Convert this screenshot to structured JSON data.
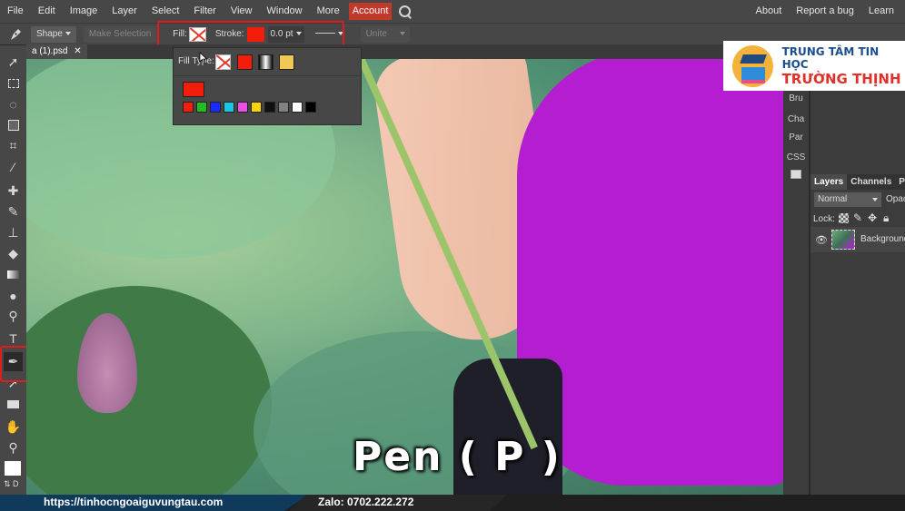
{
  "menu": {
    "items": [
      "File",
      "Edit",
      "Image",
      "Layer",
      "Select",
      "Filter",
      "View",
      "Window",
      "More",
      "Account"
    ],
    "right": [
      "About",
      "Report a bug",
      "Learn"
    ],
    "active_color": "#c0392b"
  },
  "options": {
    "shape_label": "Shape",
    "make_selection": "Make Selection",
    "fill_label": "Fill:",
    "stroke_label": "Stroke:",
    "stroke_width": "0.0 pt",
    "unite_label": "Unite",
    "stroke_color": "#f21d0a",
    "highlight_color": "#e21b1b"
  },
  "document": {
    "tab_title": "a (1).psd"
  },
  "popup": {
    "fill_type_label": "Fill Type:",
    "selected_color": "#f21d0a",
    "palette": [
      "#f21d0a",
      "#1fbf1f",
      "#1a2bff",
      "#18c7e6",
      "#e94ee6",
      "#ffd400",
      "#111111",
      "#808080",
      "#ffffff",
      "#000000"
    ]
  },
  "right_strip": [
    "Bru",
    "Cha",
    "Par",
    "CSS"
  ],
  "layers": {
    "tabs": [
      "Layers",
      "Channels",
      "Pa"
    ],
    "blend_mode": "Normal",
    "opacity_label": "Opac",
    "lock_label": "Lock:",
    "layer_name": "Background"
  },
  "caption": "Pen ( P )",
  "logo": {
    "line1": "TRUNG TÂM TIN HỌC",
    "line2": "TRƯỜNG THỊNH"
  },
  "footer": {
    "website": "https://tinhocngoaiguvungtau.com",
    "zalo": "Zalo: 0702.222.272"
  },
  "tools": [
    "move-tool",
    "marquee-tool",
    "lasso-tool",
    "quick-selection-tool",
    "crop-tool",
    "eyedropper-tool",
    "healing-tool",
    "brush-tool",
    "clone-stamp-tool",
    "eraser-tool",
    "gradient-tool",
    "blur-tool",
    "dodge-tool",
    "type-tool",
    "pen-tool",
    "path-selection-tool",
    "rectangle-tool",
    "hand-tool",
    "zoom-tool"
  ]
}
